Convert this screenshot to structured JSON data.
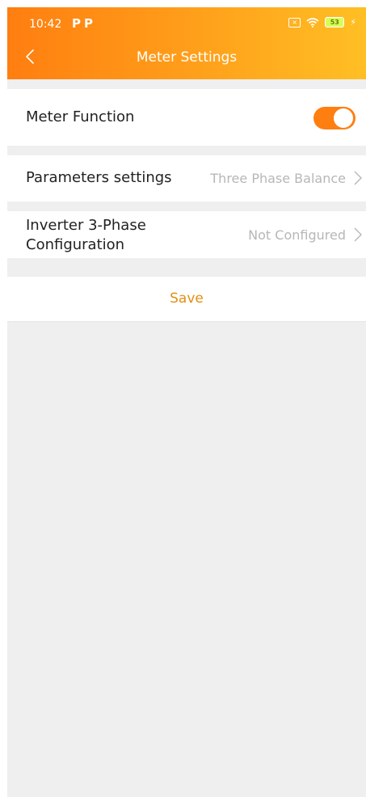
{
  "status_bar": {
    "time": "10:42",
    "carrier_icons": [
      "P",
      "P"
    ],
    "battery_level": "53"
  },
  "header": {
    "title": "Meter Settings",
    "back_icon": "chevron-left-icon"
  },
  "meter_function": {
    "label": "Meter Function",
    "enabled": true
  },
  "parameters": {
    "label": "Parameters settings",
    "value": "Three Phase Balance"
  },
  "inverter": {
    "label_line1": "Inverter 3-Phase",
    "label_line2": "Configuration",
    "value": "Not Configured"
  },
  "actions": {
    "save_label": "Save"
  },
  "colors": {
    "accent": "#ff7e10",
    "save_text": "#e38f12",
    "background": "#efefef"
  }
}
